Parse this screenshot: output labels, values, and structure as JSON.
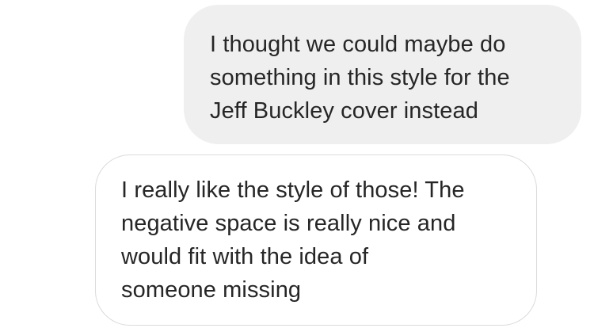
{
  "messages": [
    {
      "direction": "sent",
      "lines": [
        "I thought we could maybe do",
        "something in this style for the",
        "Jeff Buckley cover instead"
      ]
    },
    {
      "direction": "received",
      "lines": [
        "I really like the style of those! The",
        "negative space is really nice and",
        "would fit with the idea of",
        "someone missing"
      ]
    }
  ],
  "colors": {
    "sent_bubble_bg": "#efefef",
    "received_bubble_border": "#dbdbdb",
    "text": "#262626",
    "background": "#ffffff"
  }
}
